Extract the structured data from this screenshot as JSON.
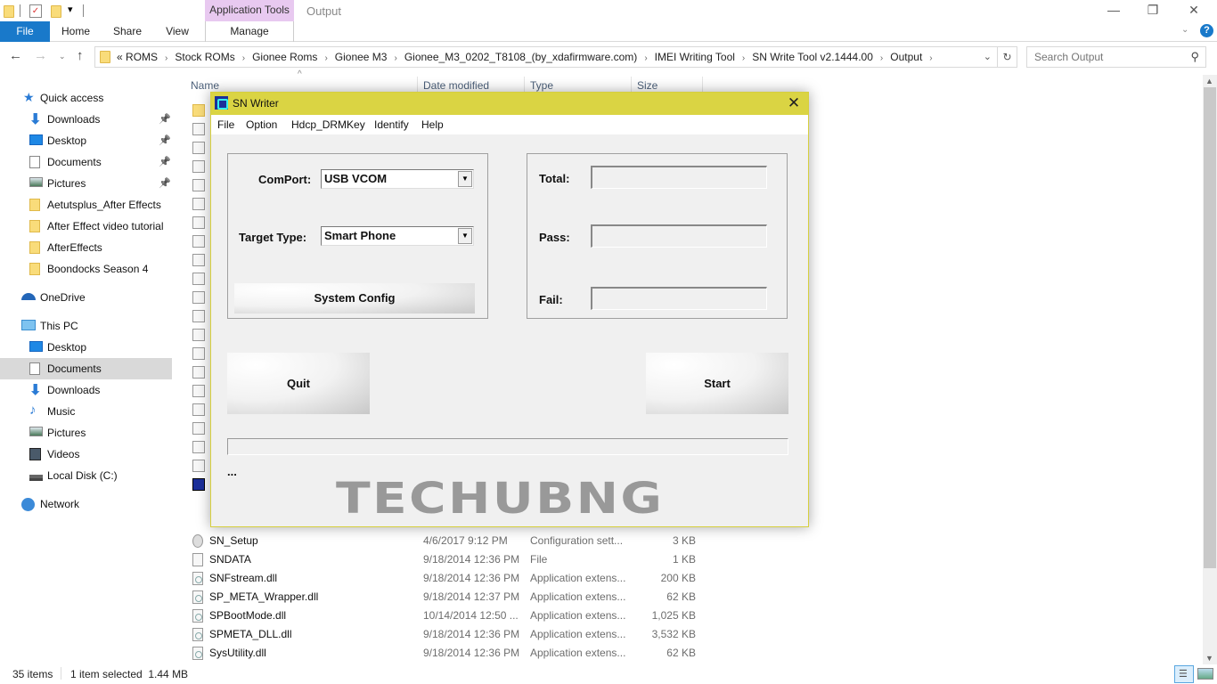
{
  "window": {
    "title": "Output",
    "context_tab": "Application Tools",
    "controls": {
      "minimize": "—",
      "maximize": "❐",
      "close": "✕"
    }
  },
  "ribbon": {
    "tabs": [
      "File",
      "Home",
      "Share",
      "View",
      "Manage"
    ],
    "help": "?"
  },
  "address": {
    "crumbs": [
      "«",
      "ROMS",
      "Stock ROMs",
      "Gionee Roms",
      "Gionee M3",
      "Gionee_M3_0202_T8108_(by_xdafirmware.com)",
      "IMEI Writing Tool",
      "SN Write Tool v2.1444.00",
      "Output"
    ],
    "search_placeholder": "Search Output"
  },
  "nav": {
    "quick_access": "Quick access",
    "items": [
      {
        "label": "Downloads",
        "icon": "downloads-icon",
        "pinned": true
      },
      {
        "label": "Desktop",
        "icon": "desktop-icon",
        "pinned": true
      },
      {
        "label": "Documents",
        "icon": "documents-icon",
        "pinned": true
      },
      {
        "label": "Pictures",
        "icon": "pictures-icon",
        "pinned": true
      },
      {
        "label": "Aetutsplus_After Effects",
        "icon": "folder-icon",
        "pinned": false
      },
      {
        "label": "After Effect video tutorial",
        "icon": "folder-icon",
        "pinned": false
      },
      {
        "label": "AfterEffects",
        "icon": "folder-icon",
        "pinned": false
      },
      {
        "label": "Boondocks Season 4",
        "icon": "folder-icon",
        "pinned": false
      }
    ],
    "onedrive": "OneDrive",
    "this_pc": "This PC",
    "pc_items": [
      {
        "label": "Desktop",
        "icon": "desktop-icon"
      },
      {
        "label": "Documents",
        "icon": "documents-icon",
        "selected": true
      },
      {
        "label": "Downloads",
        "icon": "downloads-icon"
      },
      {
        "label": "Music",
        "icon": "music-icon"
      },
      {
        "label": "Pictures",
        "icon": "pictures-icon"
      },
      {
        "label": "Videos",
        "icon": "videos-icon"
      },
      {
        "label": "Local Disk (C:)",
        "icon": "disk-icon"
      }
    ],
    "network": "Network"
  },
  "columns": {
    "name": "Name",
    "date": "Date modified",
    "type": "Type",
    "size": "Size"
  },
  "files": [
    {
      "name": "SN_Setup",
      "date": "4/6/2017 9:12 PM",
      "type": "Configuration sett...",
      "size": "3 KB",
      "kind": "config"
    },
    {
      "name": "SNDATA",
      "date": "9/18/2014 12:36 PM",
      "type": "File",
      "size": "1 KB",
      "kind": "file"
    },
    {
      "name": "SNFstream.dll",
      "date": "9/18/2014 12:36 PM",
      "type": "Application extens...",
      "size": "200 KB",
      "kind": "dll"
    },
    {
      "name": "SP_META_Wrapper.dll",
      "date": "9/18/2014 12:37 PM",
      "type": "Application extens...",
      "size": "62 KB",
      "kind": "dll"
    },
    {
      "name": "SPBootMode.dll",
      "date": "10/14/2014 12:50 ...",
      "type": "Application extens...",
      "size": "1,025 KB",
      "kind": "dll"
    },
    {
      "name": "SPMETA_DLL.dll",
      "date": "9/18/2014 12:36 PM",
      "type": "Application extens...",
      "size": "3,532 KB",
      "kind": "dll"
    },
    {
      "name": "SysUtility.dll",
      "date": "9/18/2014 12:36 PM",
      "type": "Application extens...",
      "size": "62 KB",
      "kind": "dll"
    }
  ],
  "status": {
    "count": "35 items",
    "selection": "1 item selected  1.44 MB"
  },
  "dialog": {
    "title": "SN Writer",
    "close": "✕",
    "menu": [
      "File",
      "Option",
      "Hdcp_DRMKey",
      "Identify",
      "Help"
    ],
    "comport_label": "ComPort:",
    "comport_value": "USB VCOM",
    "target_label": "Target Type:",
    "target_value": "Smart Phone",
    "system_config": "System Config",
    "total_label": "Total:",
    "pass_label": "Pass:",
    "fail_label": "Fail:",
    "total_value": "",
    "pass_value": "",
    "fail_value": "",
    "quit": "Quit",
    "start": "Start",
    "progress": 0,
    "status_text": "...",
    "watermark": "TECHUBNG"
  },
  "colors": {
    "accent": "#1979ca",
    "dialog_title": "#dad443",
    "context_tab": "#e8c9f0"
  }
}
